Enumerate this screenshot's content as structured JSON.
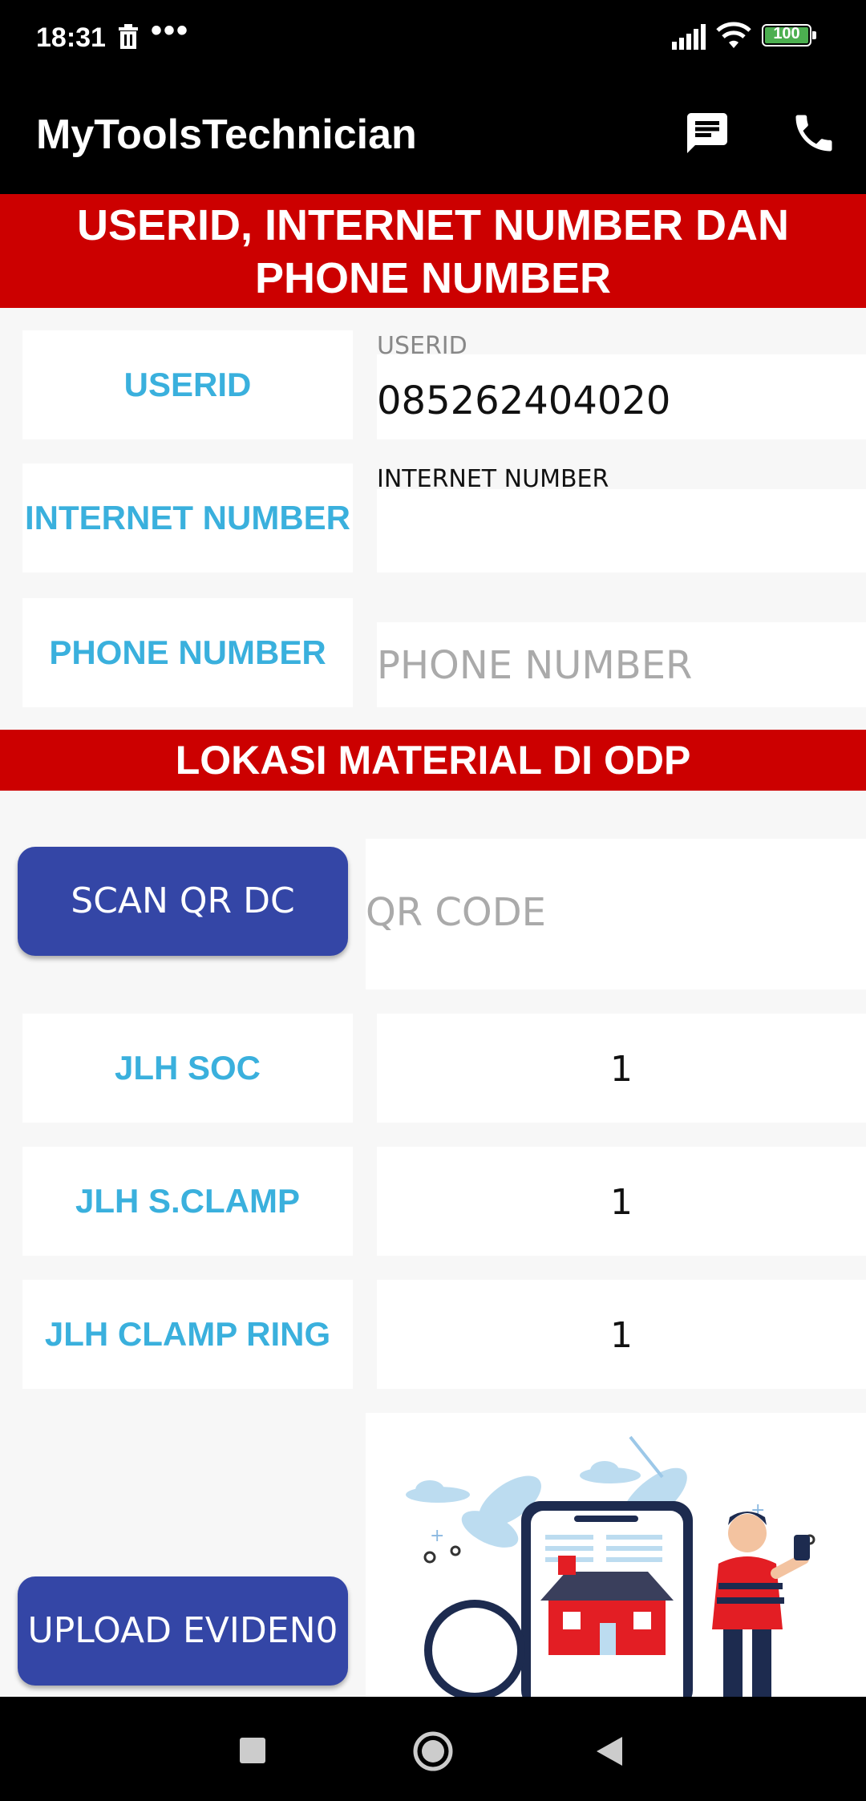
{
  "status": {
    "time": "18:31",
    "dots": "•••",
    "battery": "100",
    "battery_level": 1.0
  },
  "appbar": {
    "title": "MyToolsTechnician"
  },
  "section1": {
    "title": "USERID, INTERNET NUMBER DAN PHONE NUMBER"
  },
  "userid": {
    "label": "USERID",
    "float_label": "USERID",
    "value": "085262404020"
  },
  "internet": {
    "label": "INTERNET NUMBER",
    "float_label": "INTERNET NUMBER",
    "value": ""
  },
  "phone": {
    "label": "PHONE NUMBER",
    "placeholder": "PHONE NUMBER"
  },
  "section2": {
    "title": "LOKASI MATERIAL DI ODP"
  },
  "scan": {
    "button": "SCAN QR DC",
    "placeholder": "QR CODE"
  },
  "jlh_soc": {
    "label": "JLH SOC",
    "value": "1"
  },
  "jlh_sclamp": {
    "label": "JLH S.CLAMP",
    "value": "1"
  },
  "jlh_clamp_ring": {
    "label": "JLH CLAMP RING",
    "value": "1"
  },
  "upload": {
    "button": "UPLOAD EVIDEN0"
  }
}
